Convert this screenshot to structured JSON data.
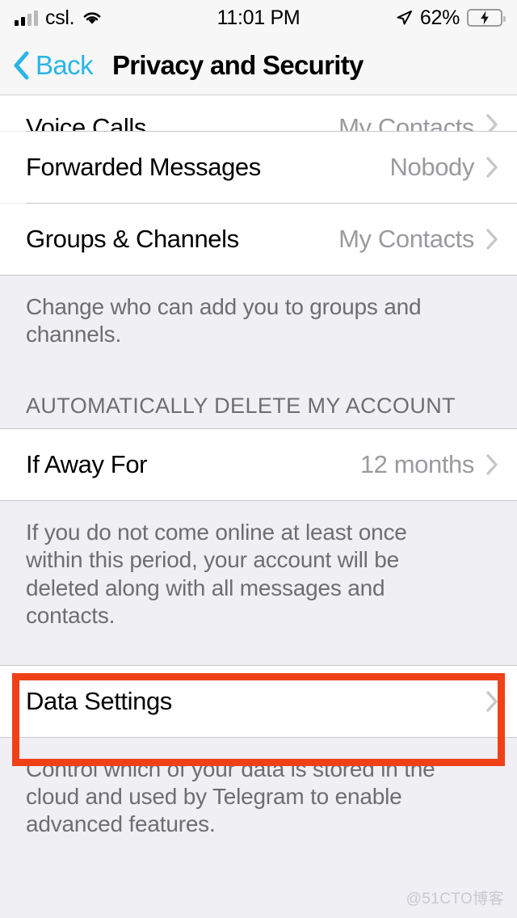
{
  "status_bar": {
    "carrier": "csl.",
    "time": "11:01 PM",
    "battery_percent": "62%",
    "battery_level": 62,
    "battery_charging": true,
    "signal_bars_filled": 2,
    "signal_bars_total": 4,
    "wifi_icon": "wifi-icon",
    "location_icon": "location-arrow-icon",
    "battery_icon": "battery-charging-icon"
  },
  "nav": {
    "back_label": "Back",
    "back_icon": "chevron-left-icon",
    "title": "Privacy and Security",
    "back_color": "#29b6e8"
  },
  "rows": {
    "voice_calls": {
      "title": "Voice Calls",
      "value": "My Contacts",
      "chevron": "chevron-right-icon"
    },
    "forwarded_messages": {
      "title": "Forwarded Messages",
      "value": "Nobody",
      "chevron": "chevron-right-icon"
    },
    "groups_channels": {
      "title": "Groups & Channels",
      "value": "My Contacts",
      "chevron": "chevron-right-icon"
    },
    "if_away_for": {
      "title": "If Away For",
      "value": "12 months",
      "chevron": "chevron-right-icon"
    },
    "data_settings": {
      "title": "Data Settings",
      "value": "",
      "chevron": "chevron-right-icon"
    }
  },
  "footnotes": {
    "groups": "Change who can add you to groups and channels.",
    "away": "If you do not come online at least once within this period, your account will be deleted along with all messages and contacts.",
    "data": "Control which of your data is stored in the cloud and used by Telegram to enable advanced features."
  },
  "group_headers": {
    "auto_delete": "AUTOMATICALLY DELETE MY ACCOUNT"
  },
  "highlight": {
    "color": "#f04018",
    "target": "Data Settings"
  },
  "watermark": {
    "text": "@51CTO博客"
  }
}
